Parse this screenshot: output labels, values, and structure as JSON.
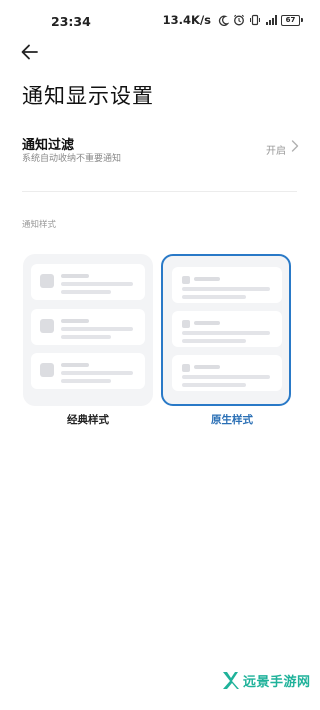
{
  "status_bar": {
    "time": "23:34",
    "net_speed": "13.4K/s",
    "battery": "67",
    "icons": [
      "moon-icon",
      "alarm-icon",
      "vibrate-icon",
      "5g-signal-icon",
      "battery-icon"
    ]
  },
  "header": {
    "back_icon": "arrow-left-icon",
    "title": "通知显示设置"
  },
  "notification_filter": {
    "title": "通知过滤",
    "description": "系统自动收纳不重要通知",
    "value": "开启",
    "chevron_icon": "chevron-right-icon"
  },
  "notification_style": {
    "section_label": "通知样式",
    "options": [
      {
        "label": "经典样式",
        "selected": false
      },
      {
        "label": "原生样式",
        "selected": true
      }
    ]
  },
  "watermark": {
    "text": "远景手游网"
  },
  "colors": {
    "accent": "#2979c7",
    "selected_label": "#2a6fb5",
    "card_bg": "#f3f4f6",
    "watermark": "#1fb29a"
  }
}
